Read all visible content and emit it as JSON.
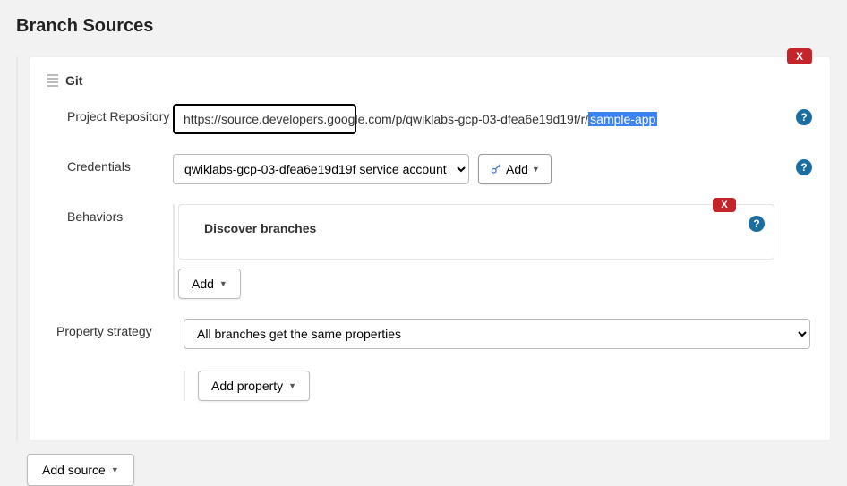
{
  "section_title": "Branch Sources",
  "git": {
    "title": "Git",
    "delete_label": "X",
    "repo": {
      "label": "Project Repository",
      "value_prefix": "https://source.developers.google.com/p/qwiklabs-gcp-03-dfea6e19d19f/r/",
      "value_highlight": "sample-app"
    },
    "credentials": {
      "label": "Credentials",
      "selected": "qwiklabs-gcp-03-dfea6e19d19f service account",
      "add_label": "Add"
    },
    "behaviors": {
      "label": "Behaviors",
      "items": [
        {
          "title": "Discover branches"
        }
      ],
      "add_label": "Add",
      "delete_label": "X"
    },
    "property_strategy": {
      "label": "Property strategy",
      "selected": "All branches get the same properties",
      "add_property_label": "Add property"
    }
  },
  "add_source_label": "Add source",
  "help_tooltip": "?"
}
